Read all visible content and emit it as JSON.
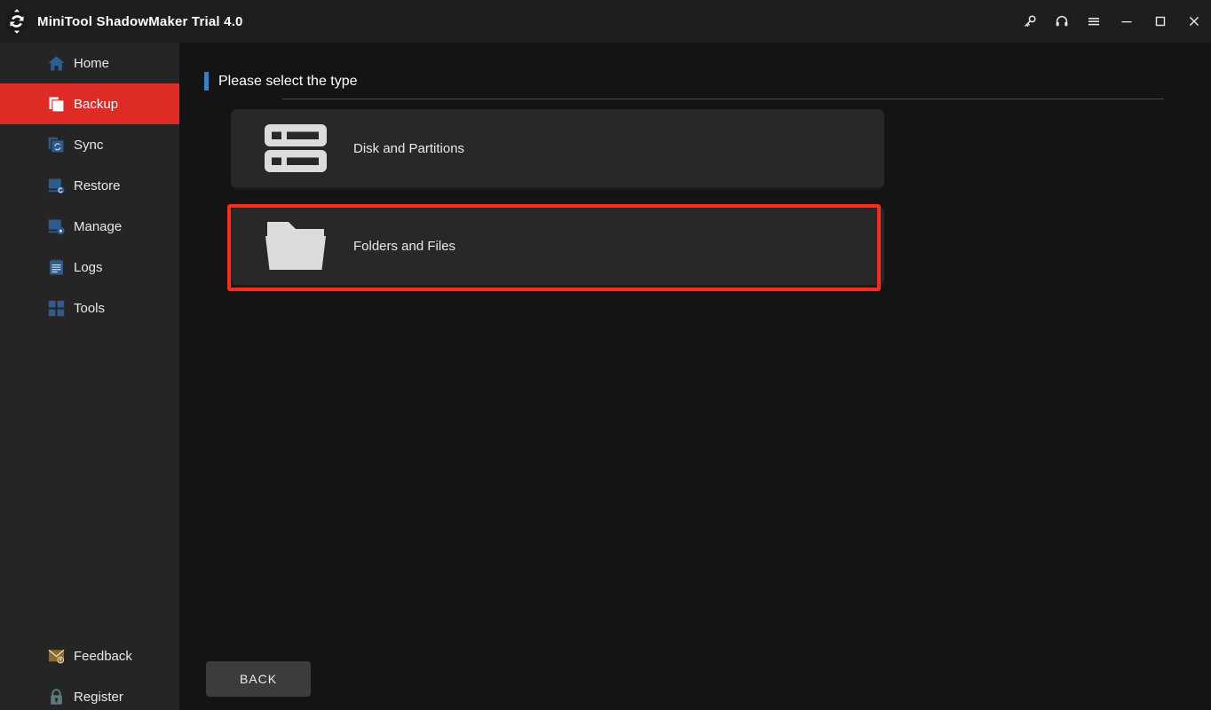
{
  "window": {
    "title": "MiniTool ShadowMaker Trial 4.0",
    "logo_icon": "circular-arrows-logo",
    "controls": [
      {
        "name": "key-icon",
        "label": "Key"
      },
      {
        "name": "headset-icon",
        "label": "Support"
      },
      {
        "name": "menu-icon",
        "label": "Menu"
      },
      {
        "name": "minimize-icon",
        "label": "Minimize"
      },
      {
        "name": "maximize-icon",
        "label": "Maximize"
      },
      {
        "name": "close-icon",
        "label": "Close"
      }
    ]
  },
  "sidebar": {
    "items": [
      {
        "label": "Home",
        "icon": "home-icon",
        "active": false
      },
      {
        "label": "Backup",
        "icon": "backup-icon",
        "active": true
      },
      {
        "label": "Sync",
        "icon": "sync-icon",
        "active": false
      },
      {
        "label": "Restore",
        "icon": "restore-icon",
        "active": false
      },
      {
        "label": "Manage",
        "icon": "manage-icon",
        "active": false
      },
      {
        "label": "Logs",
        "icon": "logs-icon",
        "active": false
      },
      {
        "label": "Tools",
        "icon": "tools-icon",
        "active": false
      }
    ],
    "bottom_items": [
      {
        "label": "Feedback",
        "icon": "envelope-icon"
      },
      {
        "label": "Register",
        "icon": "lock-icon"
      }
    ]
  },
  "main": {
    "section_title": "Please select the type",
    "cards": [
      {
        "label": "Disk and Partitions",
        "icon": "disk-icon",
        "highlighted": false
      },
      {
        "label": "Folders and Files",
        "icon": "folder-icon",
        "highlighted": true
      }
    ],
    "back_button": "BACK"
  },
  "colors": {
    "accent_red": "#de2b26",
    "accent_blue": "#3d7fc1",
    "highlight_red": "#ff2b16",
    "sidebar_bg": "#252526",
    "content_bg": "#141414",
    "card_bg": "#282828",
    "icon_blue": "#2f5c8e",
    "feedback_gold": "#8a6d29"
  }
}
